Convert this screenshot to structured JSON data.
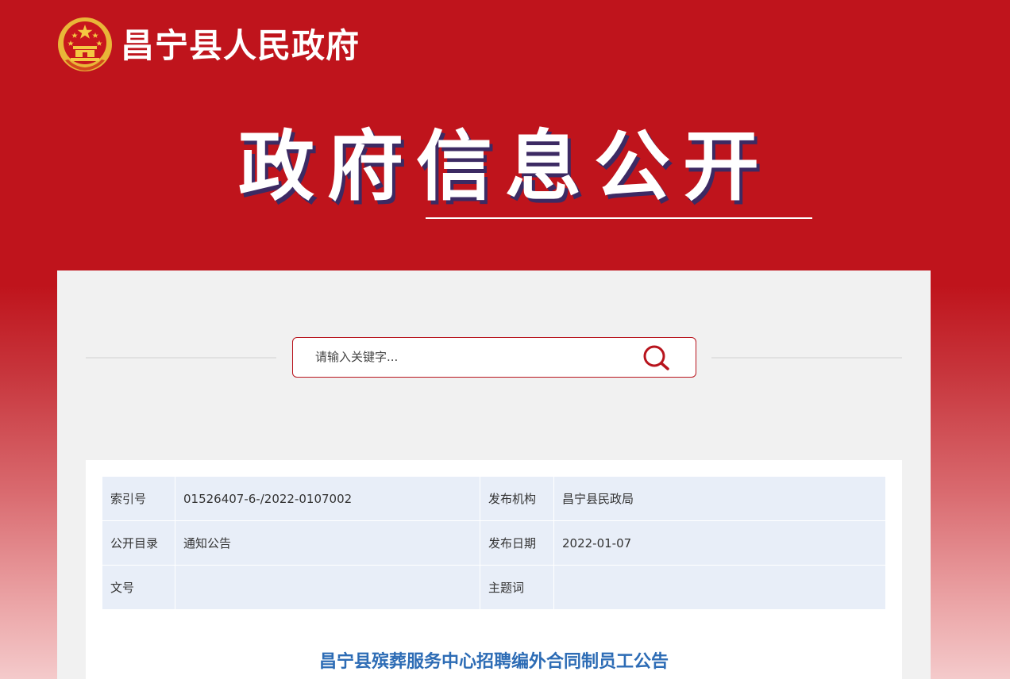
{
  "header": {
    "site_title": "昌宁县人民政府",
    "emblem_icon": "national-emblem-icon",
    "banner_title": "政府信息公开"
  },
  "search": {
    "placeholder": "请输入关键字...",
    "icon": "search-icon"
  },
  "meta": {
    "rows": [
      [
        {
          "label": "索引号",
          "value": "01526407-6-/2022-0107002"
        },
        {
          "label": "发布机构",
          "value": "昌宁县民政局"
        }
      ],
      [
        {
          "label": "公开目录",
          "value": "通知公告"
        },
        {
          "label": "发布日期",
          "value": "2022-01-07"
        }
      ],
      [
        {
          "label": "文号",
          "value": ""
        },
        {
          "label": "主题词",
          "value": ""
        }
      ]
    ]
  },
  "article": {
    "title": "昌宁县殡葬服务中心招聘编外合同制员工公告"
  },
  "colors": {
    "header_red": "#bf141c",
    "search_border": "#b8141d",
    "table_bg": "#e8eef8",
    "title_blue": "#2d6cb5"
  }
}
